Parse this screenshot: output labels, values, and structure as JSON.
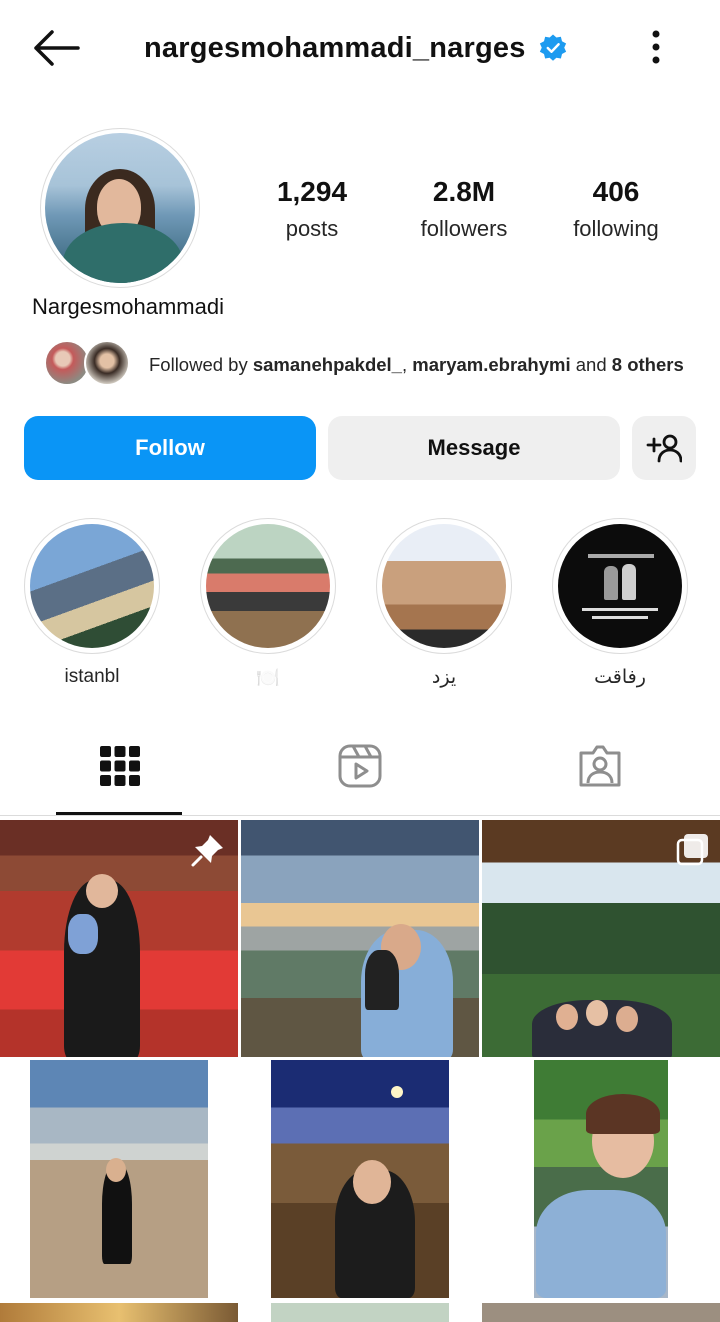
{
  "header": {
    "username": "nargesmohammadi_narges",
    "verified": true,
    "icons": {
      "back": "arrow-left-icon",
      "verified": "verified-badge-icon",
      "more": "more-vertical-icon"
    }
  },
  "profile": {
    "display_name": "Nargesmohammadi",
    "stats": [
      {
        "value": "1,294",
        "label": "posts"
      },
      {
        "value": "2.8M",
        "label": "followers"
      },
      {
        "value": "406",
        "label": "following"
      }
    ],
    "followed_by": {
      "prefix": "Followed by ",
      "user1": "samanehpakdel_",
      "separator": ", ",
      "user2": "maryam.ebrahymi",
      "middle": " and ",
      "others": "8 others"
    }
  },
  "actions": {
    "follow_label": "Follow",
    "message_label": "Message",
    "suggest_icon": "add-person-icon"
  },
  "highlights": [
    {
      "label": "istanbl"
    },
    {
      "label": "🍽️"
    },
    {
      "label": "یزد"
    },
    {
      "label": "رفاقت"
    }
  ],
  "tabs": [
    {
      "name": "posts",
      "icon": "grid-icon",
      "active": true
    },
    {
      "name": "reels",
      "icon": "reels-icon",
      "active": false
    },
    {
      "name": "tagged",
      "icon": "tagged-user-icon",
      "active": false
    }
  ],
  "colors": {
    "accent": "#0a95f6",
    "button_gray": "#efefef",
    "verified_blue": "#1d9bf0"
  }
}
